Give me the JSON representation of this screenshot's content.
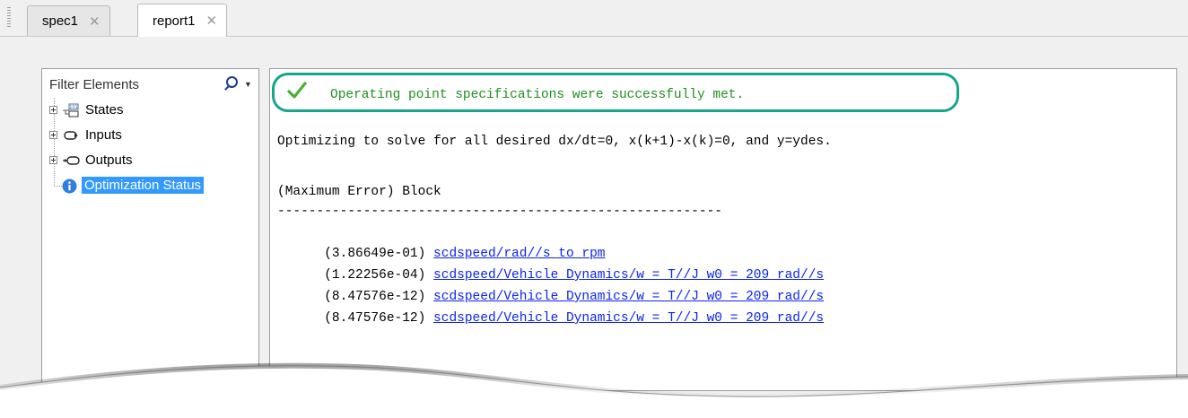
{
  "tabs": [
    {
      "label": "spec1",
      "close": "✕",
      "active": false
    },
    {
      "label": "report1",
      "close": "✕",
      "active": true
    }
  ],
  "filter": {
    "placeholder": "Filter Elements",
    "dropdown": "▼"
  },
  "tree": [
    {
      "label": "States",
      "icon": "states-icon",
      "expandable": true
    },
    {
      "label": "Inputs",
      "icon": "inputs-icon",
      "expandable": true
    },
    {
      "label": "Outputs",
      "icon": "outputs-icon",
      "expandable": true
    },
    {
      "label": "Optimization Status",
      "icon": "info-icon",
      "expandable": false,
      "selected": true
    }
  ],
  "report": {
    "success": "Operating point specifications were successfully met.",
    "intro": "Optimizing to solve for all desired dx/dt=0, x(k+1)-x(k)=0, and y=ydes.",
    "header": "(Maximum Error) Block",
    "separator": "---------------------------------------------------------",
    "rows": [
      {
        "error": "(3.86649e-01)",
        "block": "scdspeed/rad//s to rpm"
      },
      {
        "error": "(1.22256e-04)",
        "block": "scdspeed/Vehicle Dynamics/w = T//J w0 = 209 rad//s"
      },
      {
        "error": "(8.47576e-12)",
        "block": "scdspeed/Vehicle Dynamics/w = T//J w0 = 209 rad//s"
      },
      {
        "error": "(8.47576e-12)",
        "block": "scdspeed/Vehicle Dynamics/w = T//J w0 = 209 rad//s"
      }
    ]
  },
  "colors": {
    "highlight_border": "#17a58a",
    "success_text": "#1f8f1f",
    "link": "#0b24ee",
    "selection": "#3399ff"
  }
}
